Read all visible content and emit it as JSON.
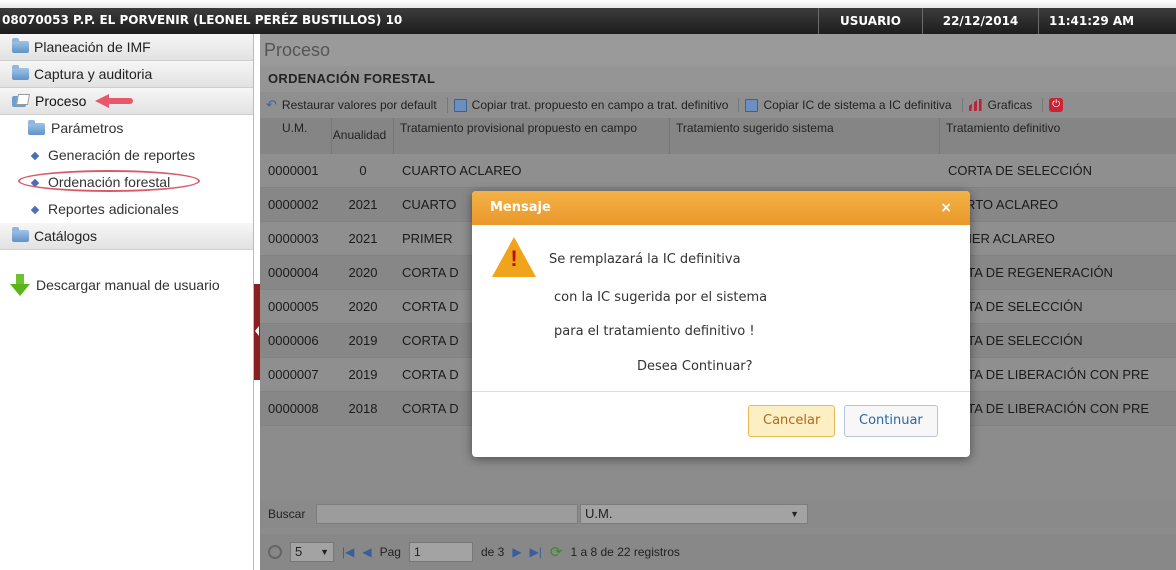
{
  "titlebar": {
    "app_title": "08070053 P.P. EL PORVENIR (LEONEL PERÉZ BUSTILLOS) 10",
    "user": "USUARIO",
    "date": "22/12/2014",
    "time": "11:41:29 AM"
  },
  "sidebar": {
    "items": [
      {
        "label": "Planeación de IMF"
      },
      {
        "label": "Captura y auditoria"
      },
      {
        "label": "Proceso"
      },
      {
        "label": "Parámetros"
      },
      {
        "label": "Generación de reportes"
      },
      {
        "label": "Ordenación forestal"
      },
      {
        "label": "Reportes adicionales"
      },
      {
        "label": "Catálogos"
      }
    ],
    "download_label": "Descargar manual de usuario"
  },
  "main": {
    "title": "Proceso",
    "section": "ORDENACIÓN FORESTAL",
    "toolbar": {
      "restore": "Restaurar valores por default",
      "copy_trat": "Copiar trat. propuesto en campo a trat. definitivo",
      "copy_ic": "Copiar IC de sistema a IC definitiva",
      "graficas": "Graficas"
    },
    "columns": {
      "um": "U.M.",
      "anualidad": "Anualidad",
      "prov": "Tratamiento provisional propuesto en campo",
      "sug": "Tratamiento sugerido sistema",
      "def": "Tratamiento definitivo"
    },
    "rows": [
      {
        "um": "0000001",
        "anu": "0",
        "prov": "CUARTO ACLAREO",
        "def": "CORTA DE SELECCIÓN"
      },
      {
        "um": "0000002",
        "anu": "2021",
        "prov": "CUARTO",
        "def": "UARTO ACLAREO"
      },
      {
        "um": "0000003",
        "anu": "2021",
        "prov": "PRIMER",
        "def": "RIMER ACLAREO"
      },
      {
        "um": "0000004",
        "anu": "2020",
        "prov": "CORTA D",
        "def": "ORTA DE REGENERACIÓN"
      },
      {
        "um": "0000005",
        "anu": "2020",
        "prov": "CORTA D",
        "def": "ORTA DE SELECCIÓN"
      },
      {
        "um": "0000006",
        "anu": "2019",
        "prov": "CORTA D",
        "def": "ORTA DE SELECCIÓN"
      },
      {
        "um": "0000007",
        "anu": "2019",
        "prov": "CORTA D",
        "def": "ORTA DE LIBERACIÓN CON PRE"
      },
      {
        "um": "0000008",
        "anu": "2018",
        "prov": "CORTA D",
        "def": "ORTA DE LIBERACIÓN CON PRE"
      }
    ],
    "search": {
      "label": "Buscar",
      "field": "U.M."
    },
    "pager": {
      "page_size": "5",
      "pag_label": "Pag",
      "page": "1",
      "of": "de 3",
      "records": "1 a 8 de 22 registros"
    }
  },
  "dialog": {
    "title": "Mensaje",
    "close": "×",
    "line1": "Se remplazará la IC definitiva",
    "line2": "con la IC sugerida por el sistema",
    "line3": "para el tratamiento definitivo !",
    "line4": "Desea Continuar?",
    "cancel": "Cancelar",
    "continue": "Continuar"
  }
}
